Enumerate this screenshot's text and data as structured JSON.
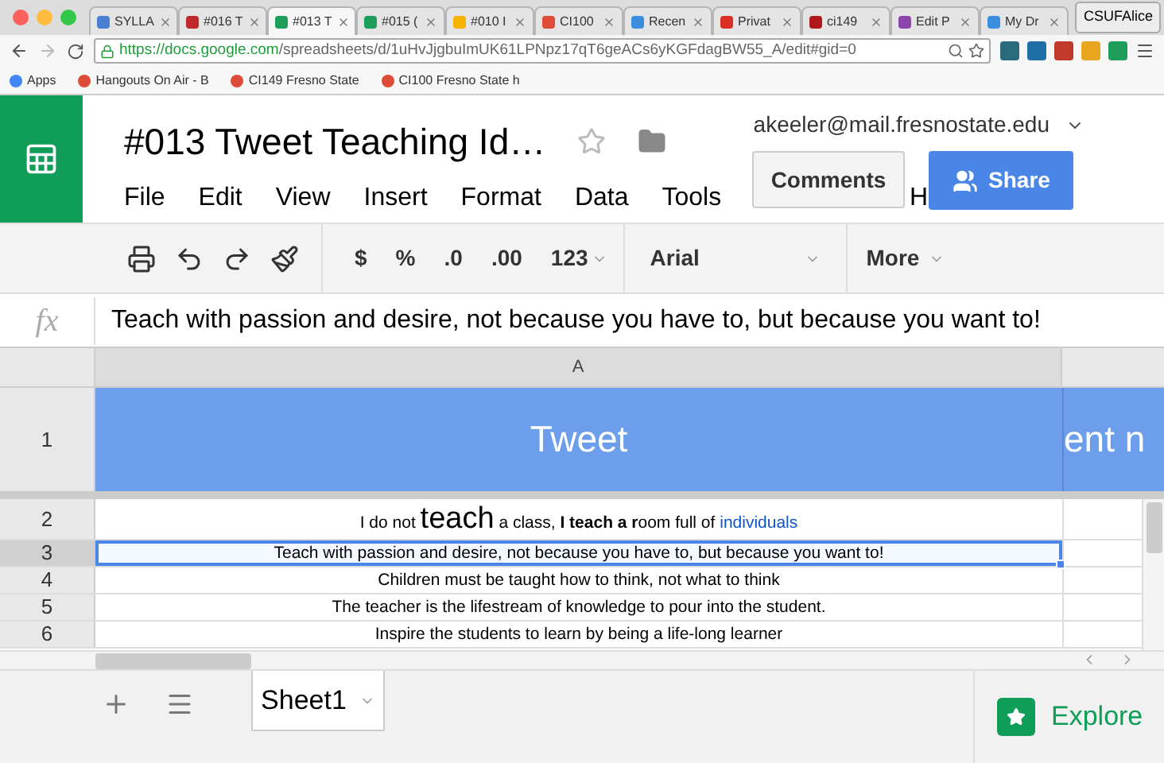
{
  "browser": {
    "tabs": [
      {
        "label": "SYLLA",
        "color": "#4a7fd4",
        "selected": false
      },
      {
        "label": "#016 T",
        "color": "#c0282d",
        "selected": false
      },
      {
        "label": "#013 T",
        "color": "#1e9e5a",
        "selected": true
      },
      {
        "label": "#015 (",
        "color": "#1e9e5a",
        "selected": false
      },
      {
        "label": "#010 I",
        "color": "#f4b400",
        "selected": false
      },
      {
        "label": "CI100",
        "color": "#dd4b39",
        "selected": false
      },
      {
        "label": "Recen",
        "color": "#3d8de0",
        "selected": false
      },
      {
        "label": "Privat",
        "color": "#d93025",
        "selected": false
      },
      {
        "label": "ci149",
        "color": "#b0181e",
        "selected": false
      },
      {
        "label": "Edit P",
        "color": "#8e44ad",
        "selected": false
      },
      {
        "label": "My Dr",
        "color": "#3d8de0",
        "selected": false
      }
    ],
    "profile": "CSUFAlice",
    "url": {
      "host": "https://docs.google.com",
      "path": "/spreadsheets/d/1uHvJjgbuImUK61LPNpz17qT6geACs6yKGFdagBW55_A/edit#gid=0"
    },
    "bookmarks": [
      {
        "label": "Apps",
        "color": "#4285f4"
      },
      {
        "label": "Hangouts On Air - B",
        "color": "#dd4b39"
      },
      {
        "label": "CI149 Fresno State",
        "color": "#dd4b39"
      },
      {
        "label": "CI100 Fresno State h",
        "color": "#dd4b39"
      }
    ]
  },
  "doc": {
    "title": "#013 Tweet Teaching Id…",
    "account": "akeeler@mail.fresnostate.edu",
    "menu": [
      "File",
      "Edit",
      "View",
      "Insert",
      "Format",
      "Data",
      "Tools",
      "H"
    ],
    "comments": "Comments",
    "share": "Share"
  },
  "toolbar": {
    "currency": "$",
    "percent": "%",
    "dec_less": ".0",
    "dec_more": ".00",
    "number_format": "123",
    "font": "Arial",
    "more": "More"
  },
  "formula_bar": {
    "label": "fx",
    "value": "Teach with passion and desire, not because you have to, but because you want to!"
  },
  "sheet": {
    "column_a": "A",
    "header_row": {
      "number": "1",
      "cell_a": "Tweet",
      "cell_b": "ent n"
    },
    "rows": [
      {
        "number": "2",
        "selected": false,
        "segments": [
          {
            "kind": "plain",
            "text": "I do not "
          },
          {
            "kind": "large",
            "text": "teach"
          },
          {
            "kind": "plain",
            "text": " a class, "
          },
          {
            "kind": "bold",
            "text": "I teach a r"
          },
          {
            "kind": "plain",
            "text": "oom full of "
          },
          {
            "kind": "link",
            "text": "individuals"
          }
        ]
      },
      {
        "number": "3",
        "selected": true,
        "segments": [
          {
            "kind": "plain",
            "text": "Teach with passion and desire, not because you have to, but because you want to!"
          }
        ]
      },
      {
        "number": "4",
        "selected": false,
        "segments": [
          {
            "kind": "plain",
            "text": "Children must be taught how to think, not what to think"
          }
        ]
      },
      {
        "number": "5",
        "selected": false,
        "segments": [
          {
            "kind": "plain",
            "text": "The teacher is the lifestream of knowledge to pour into the student."
          }
        ]
      },
      {
        "number": "6",
        "selected": false,
        "segments": [
          {
            "kind": "plain",
            "text": "Inspire the students to learn by being a life-long learner"
          }
        ]
      }
    ]
  },
  "bottom": {
    "sheet_tab": "Sheet1",
    "explore": "Explore"
  }
}
